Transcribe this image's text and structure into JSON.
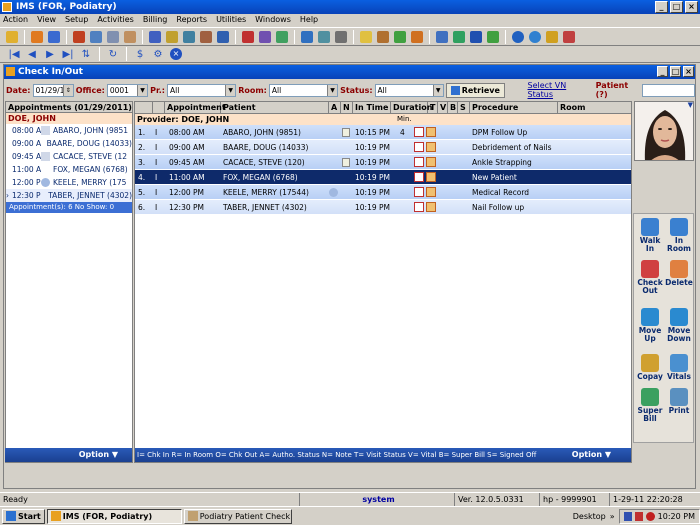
{
  "app": {
    "title": "IMS (FOR, Podiatry)"
  },
  "menu": [
    "Action",
    "View",
    "Setup",
    "Activities",
    "Billing",
    "Reports",
    "Utilities",
    "Windows",
    "Help"
  ],
  "child_window": {
    "title": "Check In/Out"
  },
  "filters": {
    "date_label": "Date:",
    "date_value": "01/29/11",
    "office_label": "Office:",
    "office_value": "0001",
    "pr_label": "Pr.:",
    "pr_value": "All",
    "room_label": "Room:",
    "room_value": "All",
    "status_label": "Status:",
    "status_value": "All",
    "retrieve_label": "Retrieve",
    "vn_status_link": "Select VN Status",
    "patient_label": "Patient (?)"
  },
  "left_panel": {
    "header": "Appointments (01/29/2011)",
    "provider": "DOE, JOHN",
    "items": [
      {
        "time": "08:00 A",
        "name": "ABARO, JOHN  (9851"
      },
      {
        "time": "09:00 A",
        "name": "BAARE, DOUG  (14033)"
      },
      {
        "time": "09:45 A",
        "name": "CACACE, STEVE  (12"
      },
      {
        "time": "11:00 A",
        "name": "FOX, MEGAN  (6768)"
      },
      {
        "time": "12:00 P",
        "name": "KEELE, MERRY  (175"
      },
      {
        "time": "12:30 P",
        "name": "TABER, JENNET  (4302)"
      }
    ],
    "summary": "Appointment(s): 6    No Show: 0",
    "option_label": "Option"
  },
  "grid": {
    "columns": [
      "Appointment",
      "Patient",
      "A",
      "N",
      "In Time",
      "Duration",
      "T",
      "V",
      "B",
      "S",
      "Procedure",
      "Room"
    ],
    "provider_row": "Provider: DOE, JOHN",
    "min_label": "Min.",
    "rows": [
      {
        "num": "1.",
        "flag": "I",
        "appt": "08:00 AM",
        "patient": "ABARO, JOHN  (9851)",
        "in_time": "10:15 PM",
        "duration": "4",
        "procedure": "DPM Follow Up"
      },
      {
        "num": "2.",
        "flag": "I",
        "appt": "09:00 AM",
        "patient": "BAARE, DOUG  (14033)",
        "in_time": "10:19 PM",
        "duration": "",
        "procedure": "Debridement of Nails"
      },
      {
        "num": "3.",
        "flag": "I",
        "appt": "09:45 AM",
        "patient": "CACACE, STEVE  (120)",
        "in_time": "10:19 PM",
        "duration": "",
        "procedure": "Ankle Strapping"
      },
      {
        "num": "4.",
        "flag": "I",
        "appt": "11:00 AM",
        "patient": "FOX, MEGAN  (6768)",
        "in_time": "10:19 PM",
        "duration": "",
        "procedure": "New Patient"
      },
      {
        "num": "5.",
        "flag": "I",
        "appt": "12:00 PM",
        "patient": "KEELE, MERRY  (17544)",
        "in_time": "10:19 PM",
        "duration": "",
        "procedure": "Medical Record"
      },
      {
        "num": "6.",
        "flag": "I",
        "appt": "12:30 PM",
        "patient": "TABER, JENNET  (4302)",
        "in_time": "10:19 PM",
        "duration": "",
        "procedure": "Nail Follow up"
      }
    ],
    "legend": "I= Chk In  R= In Room  O= Chk Out  A= Autho. Status  N= Note  T= Visit Status  V= Vital  B= Super Bill  S= Signed Off",
    "option_label": "Option"
  },
  "actions": {
    "walk_in": "Walk In",
    "in_room": "In Room",
    "check_out": "Check Out",
    "delete": "Delete",
    "move_up": "Move Up",
    "move_down": "Move Down",
    "copay": "Copay",
    "vitals": "Vitals",
    "super_bill": "Super Bill",
    "print": "Print"
  },
  "statusbar": {
    "ready": "Ready",
    "user": "system",
    "version": "Ver. 12.0.5.0331",
    "machine": "hp - 9999901",
    "datetime": "1-29-11  22:20:28"
  },
  "taskbar": {
    "start": "Start",
    "task1": "IMS (FOR, Podiatry)",
    "task2": "Podiatry Patient Check I...",
    "desktop": "Desktop",
    "clock": "10:20 PM"
  }
}
